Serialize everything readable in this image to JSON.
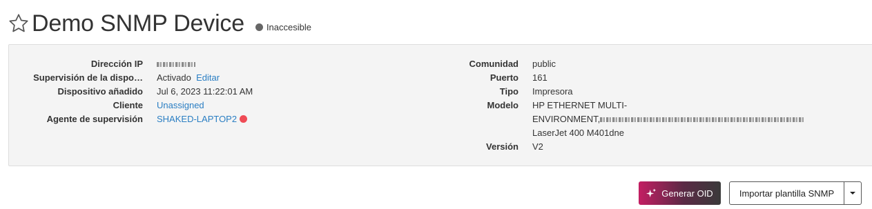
{
  "header": {
    "title": "Demo SNMP Device",
    "status": "Inaccesible",
    "status_color": "#666666"
  },
  "details_left": [
    {
      "label": "Dirección IP",
      "value": "",
      "redacted": true
    },
    {
      "label": "Supervisión de la dispo…",
      "value": "Activado",
      "link": "Editar"
    },
    {
      "label": "Dispositivo añadido",
      "value": "Jul 6, 2023 11:22:01 AM"
    },
    {
      "label": "Cliente",
      "value": "Unassigned"
    },
    {
      "label": "Agente de supervisión",
      "value": "SHAKED-LAPTOP2"
    }
  ],
  "details_right": [
    {
      "label": "Comunidad",
      "value": "public"
    },
    {
      "label": "Puerto",
      "value": "161"
    },
    {
      "label": "Tipo",
      "value": "Impresora"
    },
    {
      "label": "Modelo",
      "value_line1": "HP ETHERNET MULTI-",
      "value_line2": "ENVIRONMENT,",
      "value_line3": "LaserJet 400 M401dne"
    },
    {
      "label": "Versión",
      "value": "V2"
    }
  ],
  "actions": {
    "generate_oid": "Generar OID",
    "import_template": "Importar plantilla SNMP"
  },
  "colors": {
    "link": "#2a7ec3",
    "agent_status_dot": "#ef4b55",
    "oid_gradient_start": "#c31f63",
    "oid_gradient_end": "#3a3a3a"
  },
  "icons": {
    "favorite": "star-outline-icon",
    "generate": "sparkle-icon",
    "dropdown": "caret-down-icon"
  }
}
